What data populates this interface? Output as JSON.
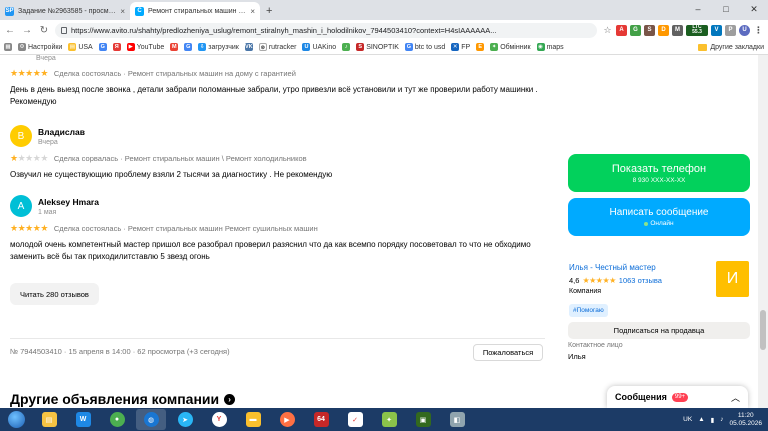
{
  "browser": {
    "tabs": [
      {
        "favicon": "SP",
        "favicon_color": "#2196f3",
        "title": "Задание №2963585 - просмотр з"
      },
      {
        "favicon": "C",
        "favicon_color": "#0af",
        "title": "Ремонт стиральных машин и хол"
      }
    ],
    "url": "https://www.avito.ru/shahty/predlozheniya_uslug/remont_stiralnyh_mashin_i_holodilnikov_7944503410?context=H4sIAAAAAA...",
    "bookmarks": [
      "Настройки",
      "USA",
      "YouTube",
      "",
      "загрузчик",
      "",
      "rutracker",
      "UAKino",
      "",
      "SINOPTIK",
      "btc to usd",
      "FP",
      "",
      "Обмінник",
      "maps"
    ],
    "other_bookmarks": "Другие закладки",
    "ext_ltc": "LTC",
    "ext_ltc_val": "55.3"
  },
  "reviews": [
    {
      "date": "Вчера",
      "rating": 5,
      "meta": "Сделка состоялась · Ремонт стиральных машин на дому с гарантией",
      "text": "День в день выезд после звонка , детали забрали поломанные забрали, утро привезли всё установили и тут же проверили работу машинки . Рекомендую"
    },
    {
      "initial": "В",
      "avatar_color": "#ffcc00",
      "name": "Владислав",
      "date": "Вчера",
      "rating": 1,
      "meta": "Сделка сорвалась · Ремонт стиральных машин \\ Ремонт холодильников",
      "text": "Озвучил не существующию проблему взяли 2 тысячи за диагностику . Не рекомендую"
    },
    {
      "initial": "A",
      "avatar_color": "#00bfd6",
      "name": "Aleksey Hmara",
      "date": "1 мая",
      "rating": 5,
      "meta": "Сделка состоялась · Ремонт стиральных машин Ремонт сушильных машин",
      "text": "молодой очень компетентный мастер пришол все разобрал проверил разяснил что да как всемпо порядку посоветовал то что не обходимо заменить всё бы так приходилитставлю 5 звезд огонь"
    }
  ],
  "read_more": "Читать 280 отзывов",
  "ad_info": "№ 7944503410 · 15 апреля в 14:00 · 62 просмотра (+3 сегодня)",
  "report_button": "Пожаловаться",
  "section_title": "Другие объявления компании",
  "sidebar": {
    "phone_button": "Показать телефон",
    "phone_number": "8 930 XXX-XX-XX",
    "message_button": "Написать сообщение",
    "online": "Онлайн",
    "seller_name": "Илья - Честный мастер",
    "seller_rating": "4,6",
    "seller_stars": 4.6,
    "reviews_count": "1063 отзыва",
    "seller_type": "Компания",
    "seller_initial": "И",
    "tag": "#Помогаю",
    "subscribe": "Подписаться на продавца",
    "contact_label": "Контактное лицо",
    "contact_name": "Илья"
  },
  "messages": {
    "label": "Сообщения",
    "badge": "99+"
  },
  "taskbar": {
    "lang": "UK",
    "time": "11:20",
    "date": "05.05.2026"
  }
}
